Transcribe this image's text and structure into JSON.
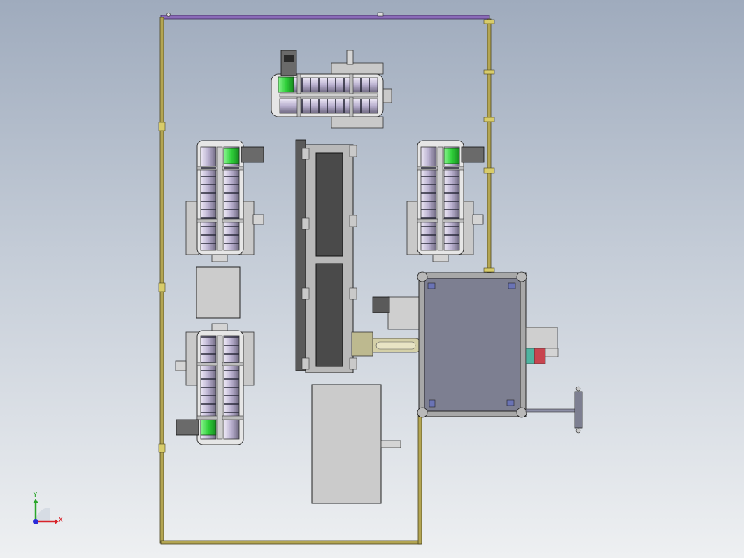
{
  "view": {
    "background_top": "#aab5c4",
    "background_bottom": "#e9ecef"
  },
  "palette": {
    "frame_rail": "#a89b4a",
    "frame_rail_top": "#8a6bb8",
    "machine_gray": "#c9c9c9",
    "panel_dark": "#4a4a4a",
    "table_gray": "#cfcfcf",
    "enclosure": "#7d7f91",
    "roller_lavender": "#c9c2d8",
    "roller_shadow": "#5a5a6a",
    "motor_green": "#2fd03a",
    "accent_red": "#c8454f",
    "accent_teal": "#4fb4a0"
  },
  "triad": {
    "x_label": "X",
    "y_label": "Y",
    "x_color": "#d8232a",
    "y_color": "#2aa62a",
    "z_color": "#2a2ad8"
  }
}
